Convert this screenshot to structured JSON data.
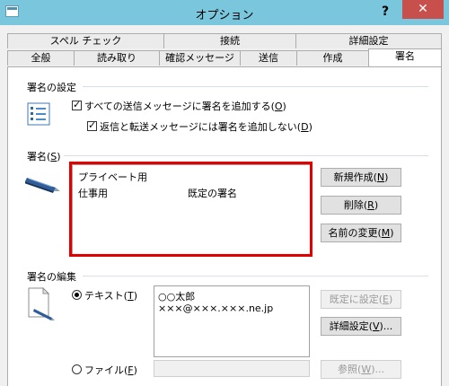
{
  "window": {
    "title": "オプション",
    "help": "?",
    "close": "✕"
  },
  "tabs": {
    "row_back": [
      "スペル チェック",
      "接続",
      "詳細設定"
    ],
    "row_front": [
      "全般",
      "読み取り",
      "確認メッセージ",
      "送信",
      "作成",
      "署名"
    ],
    "active": "署名"
  },
  "sig_settings": {
    "title": "署名の設定",
    "add_to_all": {
      "prefix": "すべての送信メッセージに署名を追加する(",
      "key": "O",
      "suffix": ")"
    },
    "no_reply": {
      "prefix": "返信と転送メッセージには署名を追加しない(",
      "key": "D",
      "suffix": ")"
    }
  },
  "signatures": {
    "title_prefix": "署名(",
    "title_key": "S",
    "title_suffix": ")",
    "items": [
      {
        "name": "プライベート用",
        "note": ""
      },
      {
        "name": "仕事用",
        "note": "既定の署名"
      }
    ],
    "new_button": {
      "prefix": "新規作成(",
      "key": "N",
      "suffix": ")"
    },
    "delete_button": {
      "prefix": "削除(",
      "key": "R",
      "suffix": ")"
    },
    "rename_button": {
      "prefix": "名前の変更(",
      "key": "M",
      "suffix": ")"
    }
  },
  "edit": {
    "title": "署名の編集",
    "text_radio": {
      "prefix": "テキスト(",
      "key": "T",
      "suffix": ")"
    },
    "text_lines": [
      "○○太郎",
      "×××@×××.×××.ne.jp"
    ],
    "default_button": {
      "prefix": "既定に設定(",
      "key": "E",
      "suffix": ")"
    },
    "advanced_button": {
      "prefix": "詳細設定(",
      "key": "V",
      "suffix": ")..."
    },
    "file_radio": {
      "prefix": "ファイル(",
      "key": "F",
      "suffix": ")"
    },
    "browse_button": {
      "prefix": "参照(",
      "key": "W",
      "suffix": ")..."
    }
  }
}
